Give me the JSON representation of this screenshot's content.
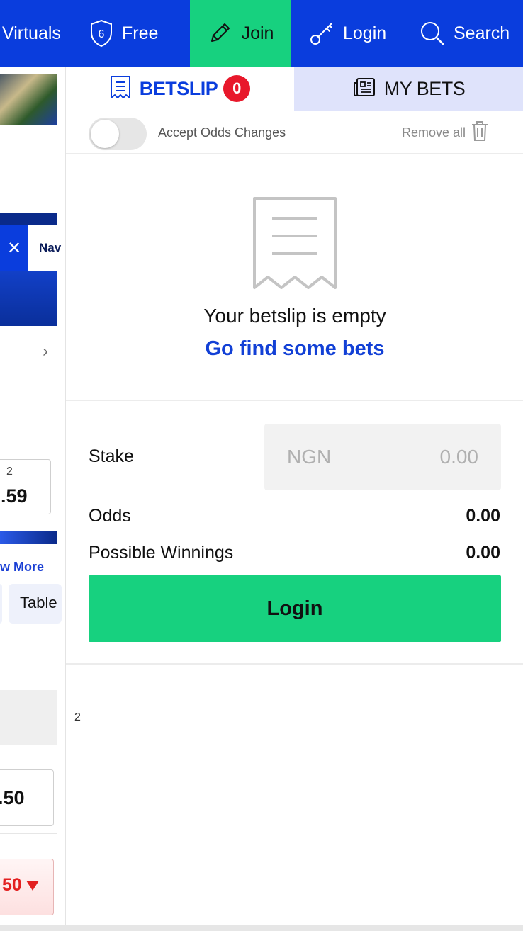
{
  "nav": {
    "virtuals": "Virtuals",
    "free_badge": "6",
    "free": "Free",
    "join": "Join",
    "login": "Login",
    "search": "Search"
  },
  "background_page": {
    "banner_text": "Nav",
    "odds_1_label": "2",
    "odds_1_value": ".59",
    "view_more": "w More",
    "tab_table": "Table",
    "odds_2_value": ".50",
    "odds_3_value": "50"
  },
  "betslip": {
    "tab_betslip": "BETSLIP",
    "count": "0",
    "tab_mybets": "MY BETS",
    "accept_odds": "Accept Odds Changes",
    "accept_odds_enabled": false,
    "remove_all": "Remove all",
    "empty_text": "Your betslip is empty",
    "find_bets": "Go find some bets",
    "stake_label": "Stake",
    "currency": "NGN",
    "stake_placeholder": "0.00",
    "odds_label": "Odds",
    "odds_value": "0.00",
    "winnings_label": "Possible Winnings",
    "winnings_value": "0.00",
    "login_button": "Login",
    "footer_number": "2"
  },
  "colors": {
    "brand_blue": "#0a3ddd",
    "accent_green": "#17d17f",
    "badge_red": "#e8182b",
    "mybets_tab_bg": "#dfe3fb"
  }
}
